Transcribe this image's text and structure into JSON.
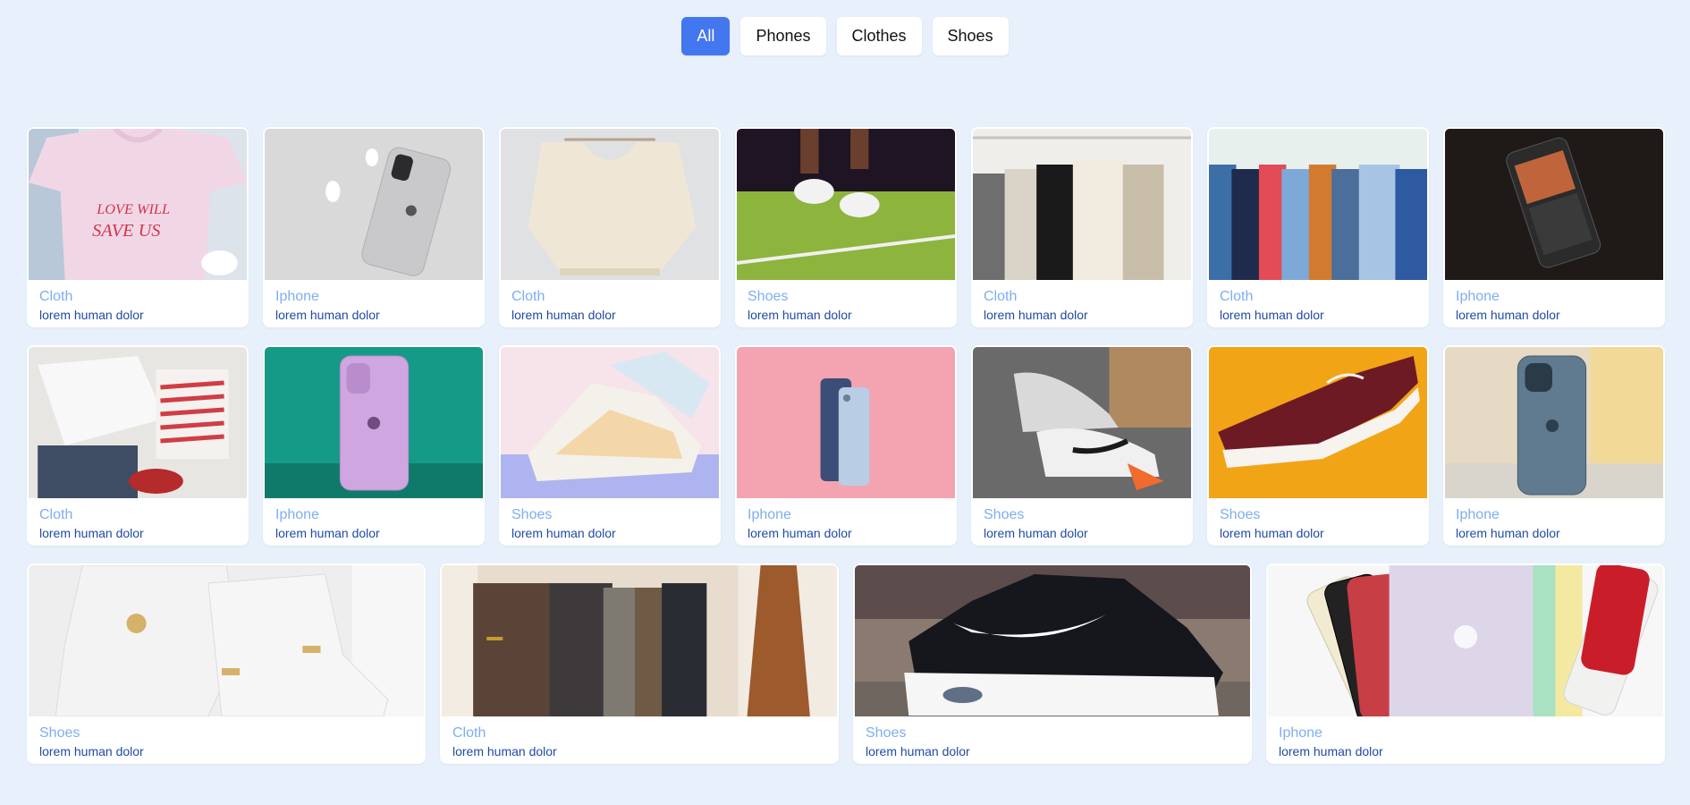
{
  "filters": [
    {
      "label": "All",
      "active": true
    },
    {
      "label": "Phones",
      "active": false
    },
    {
      "label": "Clothes",
      "active": false
    },
    {
      "label": "Shoes",
      "active": false
    }
  ],
  "cards": [
    {
      "category": "Cloth",
      "desc": "lorem human dolor",
      "image": "pink-tshirt"
    },
    {
      "category": "Iphone",
      "desc": "lorem human dolor",
      "image": "iphone-airpods"
    },
    {
      "category": "Cloth",
      "desc": "lorem human dolor",
      "image": "knit-poncho"
    },
    {
      "category": "Shoes",
      "desc": "lorem human dolor",
      "image": "jumping-sneakers"
    },
    {
      "category": "Cloth",
      "desc": "lorem human dolor",
      "image": "clothes-rack"
    },
    {
      "category": "Cloth",
      "desc": "lorem human dolor",
      "image": "shirts-hangers"
    },
    {
      "category": "Iphone",
      "desc": "lorem human dolor",
      "image": "iphone-dark"
    },
    {
      "category": "Cloth",
      "desc": "lorem human dolor",
      "image": "folded-clothes"
    },
    {
      "category": "Iphone",
      "desc": "lorem human dolor",
      "image": "iphone-purple"
    },
    {
      "category": "Shoes",
      "desc": "lorem human dolor",
      "image": "pastel-sneakers"
    },
    {
      "category": "Iphone",
      "desc": "lorem human dolor",
      "image": "iphone-pink-bg"
    },
    {
      "category": "Shoes",
      "desc": "lorem human dolor",
      "image": "running-shoes"
    },
    {
      "category": "Shoes",
      "desc": "lorem human dolor",
      "image": "maroon-sneaker"
    },
    {
      "category": "Iphone",
      "desc": "lorem human dolor",
      "image": "iphone-blue"
    },
    {
      "category": "Shoes",
      "desc": "lorem human dolor",
      "image": "white-high-tops"
    },
    {
      "category": "Cloth",
      "desc": "lorem human dolor",
      "image": "jackets-rack"
    },
    {
      "category": "Shoes",
      "desc": "lorem human dolor",
      "image": "airmax-sneaker"
    },
    {
      "category": "Iphone",
      "desc": "lorem human dolor",
      "image": "iphone-colors"
    }
  ],
  "colors": {
    "background": "#e7f0fb",
    "accent": "#4377f0",
    "category_text": "#7eaef0",
    "desc_text": "#1f4aa6"
  }
}
